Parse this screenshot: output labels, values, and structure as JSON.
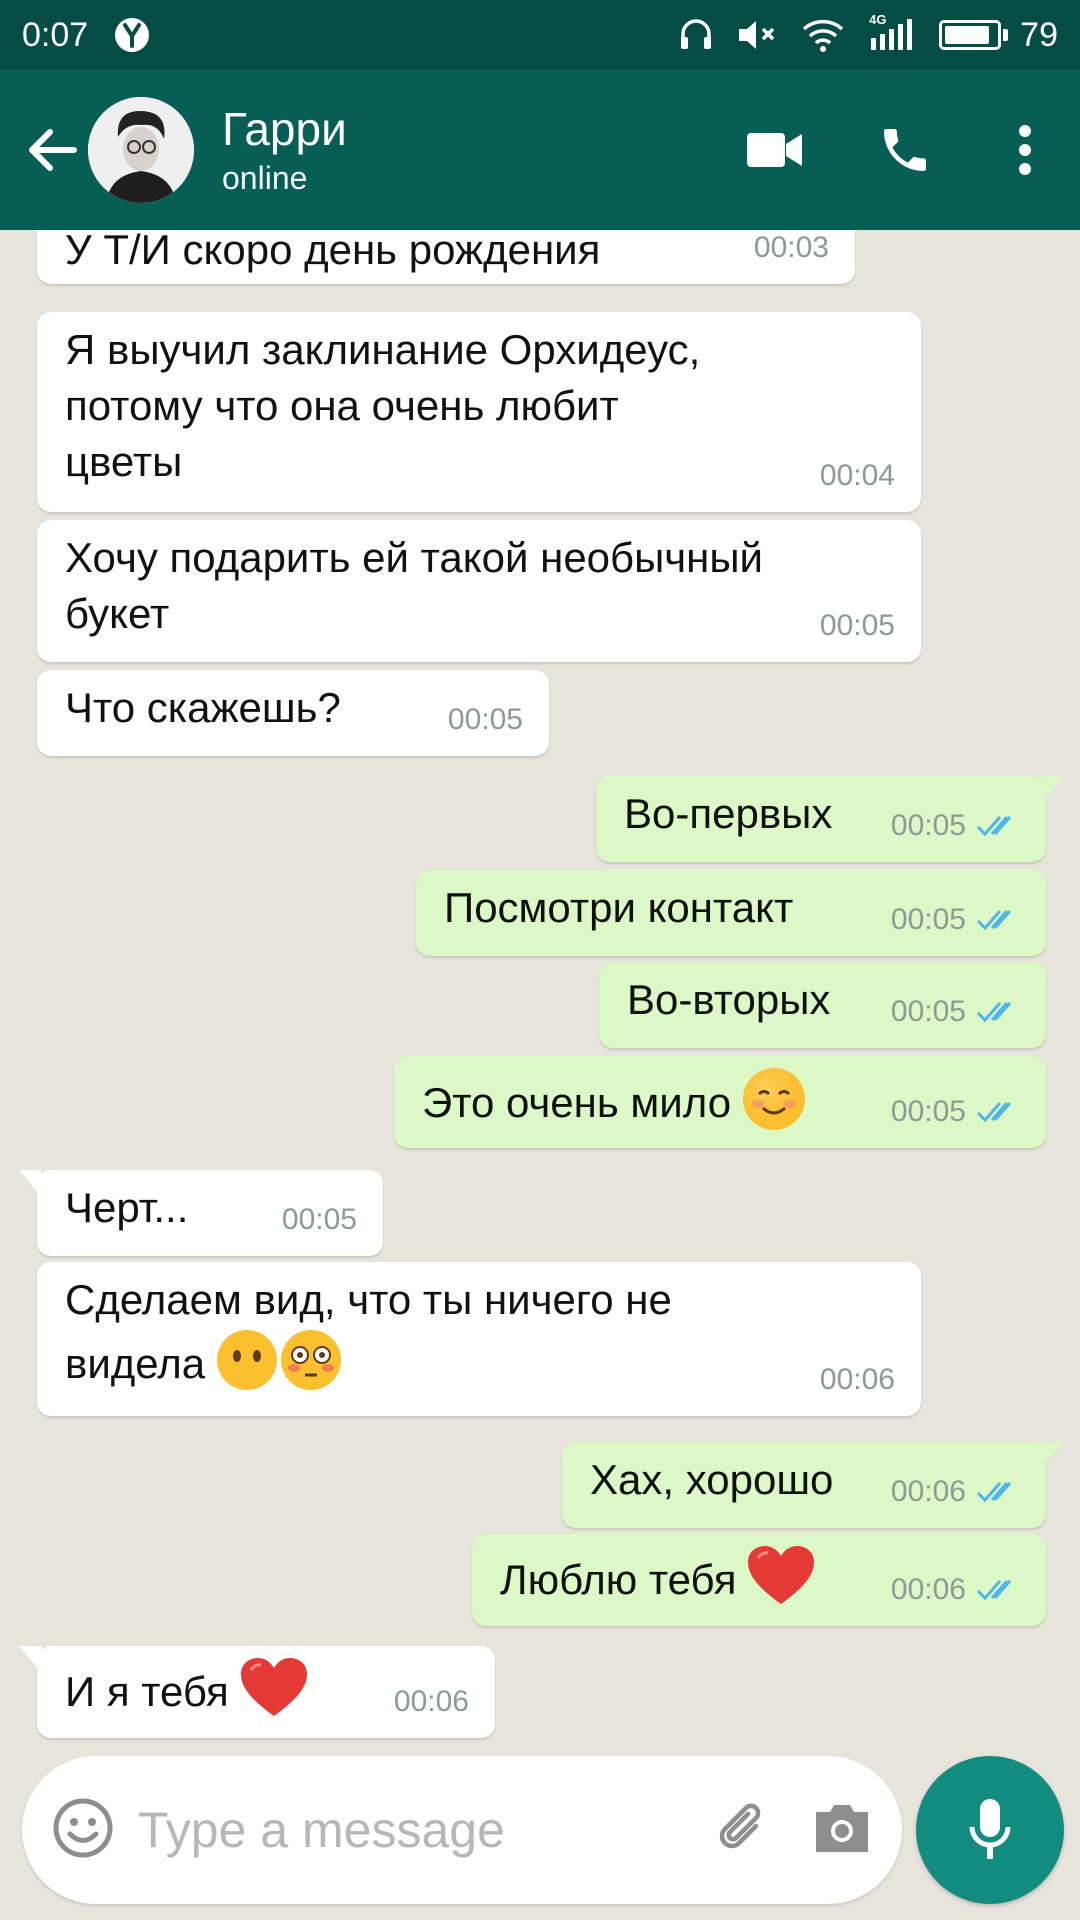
{
  "status_bar": {
    "time": "0:07",
    "battery": "79",
    "network": "4G"
  },
  "header": {
    "contact_name": "Гарри",
    "contact_status": "online"
  },
  "messages": [
    {
      "dir": "in",
      "text": "У Т/И скоро день рождения",
      "time": "00:03"
    },
    {
      "dir": "in",
      "text": "Я выучил заклинание Орхидеус,\nпотому что она очень любит\nцветы",
      "time": "00:04"
    },
    {
      "dir": "in",
      "text": "Хочу подарить ей такой необычный\nбукет",
      "time": "00:05"
    },
    {
      "dir": "in",
      "text": "Что скажешь?",
      "time": "00:05"
    },
    {
      "dir": "out",
      "text": "Во-первых",
      "time": "00:05"
    },
    {
      "dir": "out",
      "text": "Посмотри контакт",
      "time": "00:05"
    },
    {
      "dir": "out",
      "text": "Во-вторых",
      "time": "00:05"
    },
    {
      "dir": "out",
      "text": "Это очень мило",
      "time": "00:05",
      "emoji": [
        "smiling-face-emoji"
      ]
    },
    {
      "dir": "in",
      "text": "Черт...",
      "time": "00:05"
    },
    {
      "dir": "in",
      "text": "Сделаем вид, что ты ничего не\nвидела",
      "time": "00:06",
      "emoji": [
        "face-without-mouth-emoji",
        "flushed-face-emoji"
      ]
    },
    {
      "dir": "out",
      "text": "Хах, хорошо",
      "time": "00:06"
    },
    {
      "dir": "out",
      "text": "Люблю тебя",
      "time": "00:06",
      "emoji": [
        "red-heart-emoji"
      ]
    },
    {
      "dir": "in",
      "text": "И я тебя",
      "time": "00:06",
      "emoji": [
        "red-heart-emoji"
      ]
    }
  ],
  "composer": {
    "placeholder": "Type a message",
    "value": ""
  },
  "colors": {
    "header": "#075e54",
    "status_bar": "#054d44",
    "incoming": "#ffffff",
    "outgoing": "#dcf8c6",
    "ticks": "#4fb6ec",
    "fab": "#128c7e"
  }
}
